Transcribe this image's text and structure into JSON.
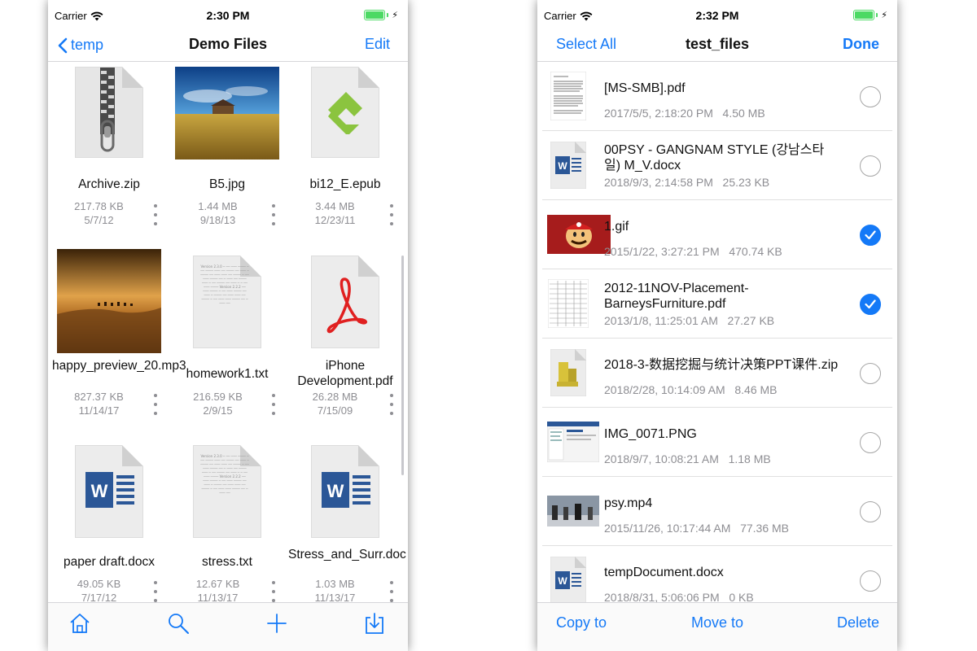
{
  "colors": {
    "accent": "#1479f7",
    "battery": "#4cd964",
    "meta": "#8e8e93",
    "word_blue": "#2b5797",
    "pdf_red": "#e02020",
    "epub_green": "#8bc43f"
  },
  "left": {
    "status": {
      "carrier": "Carrier",
      "time": "2:30 PM"
    },
    "nav": {
      "back": "temp",
      "title": "Demo Files",
      "edit": "Edit"
    },
    "files": [
      {
        "name": "Archive.zip",
        "size": "217.78 KB",
        "date": "5/7/12",
        "icon": "zip-file-icon"
      },
      {
        "name": "B5.jpg",
        "size": "1.44 MB",
        "date": "9/18/13",
        "icon": "landscape-thumbnail"
      },
      {
        "name": "bi12_E.epub",
        "size": "3.44 MB",
        "date": "12/23/11",
        "icon": "epub-file-icon"
      },
      {
        "name": "happy_preview_20.mp3",
        "size": "827.37 KB",
        "date": "11/14/17",
        "icon": "desert-thumbnail"
      },
      {
        "name": "homework1.txt",
        "size": "216.59 KB",
        "date": "2/9/15",
        "icon": "text-file-icon"
      },
      {
        "name": "iPhone Development.pdf",
        "size": "26.28 MB",
        "date": "7/15/09",
        "icon": "pdf-file-icon"
      },
      {
        "name": "paper draft.docx",
        "size": "49.05 KB",
        "date": "7/17/12",
        "icon": "word-file-icon"
      },
      {
        "name": "stress.txt",
        "size": "12.67 KB",
        "date": "11/13/17",
        "icon": "text-file-icon"
      },
      {
        "name": "Stress_and_Surr.doc",
        "size": "1.03 MB",
        "date": "11/13/17",
        "icon": "word-file-icon"
      }
    ],
    "tabs": [
      "home-icon",
      "search-icon",
      "add-icon",
      "download-icon"
    ]
  },
  "right": {
    "status": {
      "carrier": "Carrier",
      "time": "2:32 PM"
    },
    "nav": {
      "select_all": "Select All",
      "title": "test_files",
      "done": "Done"
    },
    "files": [
      {
        "name": "[MS-SMB].pdf",
        "date": "2017/5/5, 2:18:20 PM",
        "size": "4.50 MB",
        "selected": false,
        "icon": "pdf-page-thumbnail"
      },
      {
        "name": "00PSY - GANGNAM STYLE (강남스타일) M_V.docx",
        "date": "2018/9/3, 2:14:58 PM",
        "size": "25.23 KB",
        "selected": false,
        "icon": "word-file-icon"
      },
      {
        "name": "1.gif",
        "date": "2015/1/22, 3:27:21 PM",
        "size": "470.74 KB",
        "selected": true,
        "icon": "mario-thumbnail"
      },
      {
        "name": "2012-11NOV-Placement-BarneysFurniture.pdf",
        "date": "2013/1/8, 11:25:01 AM",
        "size": "27.27 KB",
        "selected": true,
        "icon": "spreadsheet-thumbnail"
      },
      {
        "name": "2018-3-数据挖掘与统计决策PPT课件.zip",
        "date": "2018/2/28, 10:14:09 AM",
        "size": "8.46 MB",
        "selected": false,
        "icon": "zip-file-icon"
      },
      {
        "name": "IMG_0071.PNG",
        "date": "2018/9/7, 10:08:21 AM",
        "size": "1.18 MB",
        "selected": false,
        "icon": "screenshot-thumbnail"
      },
      {
        "name": "psy.mp4",
        "date": "2015/11/26, 10:17:44 AM",
        "size": "77.36 MB",
        "selected": false,
        "icon": "video-thumbnail"
      },
      {
        "name": "tempDocument.docx",
        "date": "2018/8/31, 5:06:06 PM",
        "size": "0 KB",
        "selected": false,
        "icon": "word-file-icon"
      }
    ],
    "actions": {
      "copy": "Copy to",
      "move": "Move to",
      "delete": "Delete"
    }
  }
}
